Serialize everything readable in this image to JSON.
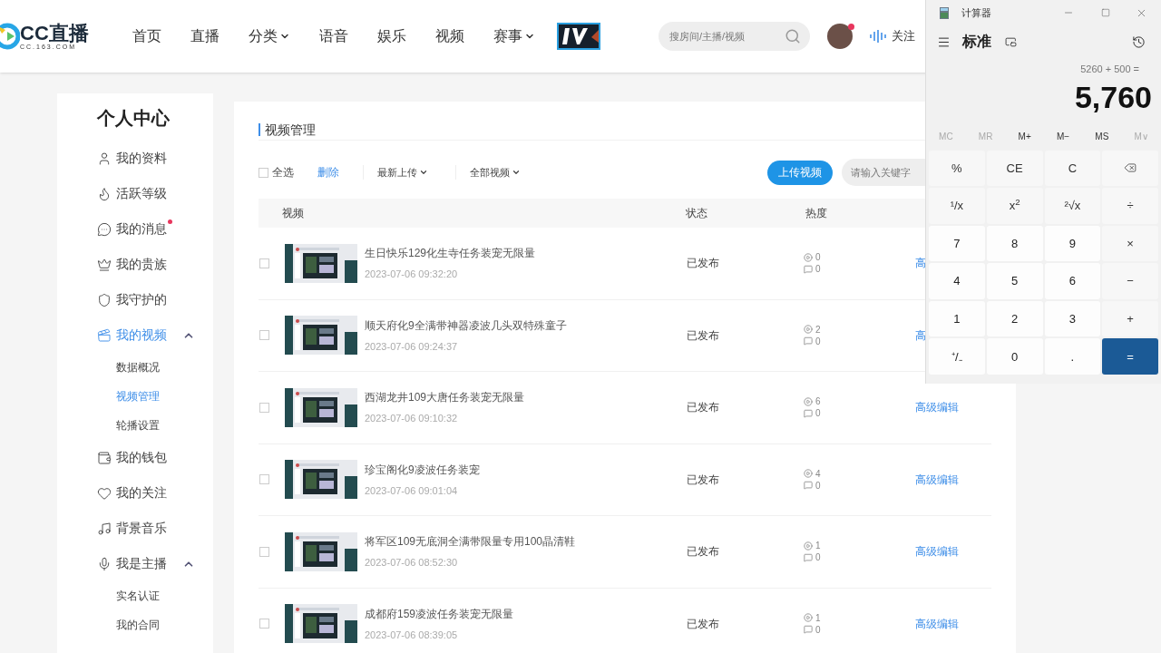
{
  "header": {
    "logo": {
      "text": "CC直播",
      "subtext": "CC.163.COM"
    },
    "nav": [
      {
        "label": "首页",
        "dropdown": false
      },
      {
        "label": "直播",
        "dropdown": false
      },
      {
        "label": "分类",
        "dropdown": true
      },
      {
        "label": "语音",
        "dropdown": false
      },
      {
        "label": "娱乐",
        "dropdown": false
      },
      {
        "label": "视频",
        "dropdown": false
      },
      {
        "label": "赛事",
        "dropdown": true
      }
    ],
    "search": {
      "placeholder": "搜房间/主播/视频"
    },
    "follow": "关注",
    "avatar_notification": true
  },
  "sidebar": {
    "title": "个人中心",
    "items": [
      {
        "label": "我的资料",
        "selected": false,
        "notification": false
      },
      {
        "label": "活跃等级",
        "selected": false,
        "notification": false
      },
      {
        "label": "我的消息",
        "selected": false,
        "notification": true
      },
      {
        "label": "我的贵族",
        "selected": false,
        "notification": false
      },
      {
        "label": "我守护的",
        "selected": false,
        "notification": false
      },
      {
        "label": "我的视频",
        "selected": true,
        "notification": false,
        "expanded": true,
        "children": [
          {
            "label": "数据概况",
            "selected": false
          },
          {
            "label": "视频管理",
            "selected": true
          },
          {
            "label": "轮播设置",
            "selected": false
          }
        ]
      },
      {
        "label": "我的钱包",
        "selected": false,
        "notification": false
      },
      {
        "label": "我的关注",
        "selected": false,
        "notification": false
      },
      {
        "label": "背景音乐",
        "selected": false,
        "notification": false
      },
      {
        "label": "我是主播",
        "selected": false,
        "notification": false,
        "expanded": true,
        "children": [
          {
            "label": "实名认证",
            "selected": false
          },
          {
            "label": "我的合同",
            "selected": false
          }
        ]
      }
    ]
  },
  "main": {
    "title": "视频管理",
    "select_all": {
      "label": "全选",
      "checked": false
    },
    "delete": "删除",
    "filters": [
      {
        "label": "最新上传"
      },
      {
        "label": "全部视频"
      }
    ],
    "upload": "上传视频",
    "search": {
      "placeholder": "请输入关键字"
    },
    "columns": [
      "视频",
      "状态",
      "热度"
    ],
    "rows": [
      {
        "checked": false,
        "title": "生日快乐129化生寺任务装宠无限量",
        "time": "2023-07-06 09:32:20",
        "status": "已发布",
        "plays": "0",
        "comments": "0",
        "action": "高"
      },
      {
        "checked": false,
        "title": "顺天府化9全满带神器凌波几头双特殊童子",
        "time": "2023-07-06 09:24:37",
        "status": "已发布",
        "plays": "2",
        "comments": "0",
        "action": "高"
      },
      {
        "checked": false,
        "title": "西湖龙井109大唐任务装宠无限量",
        "time": "2023-07-06 09:10:32",
        "status": "已发布",
        "plays": "6",
        "comments": "0",
        "action": "高级编辑"
      },
      {
        "checked": false,
        "title": "珍宝阁化9凌波任务装宠",
        "time": "2023-07-06 09:01:04",
        "status": "已发布",
        "plays": "4",
        "comments": "0",
        "action": "高级编辑"
      },
      {
        "checked": false,
        "title": "将军区109无底洞全满带限量专用100晶清鞋",
        "time": "2023-07-06 08:52:30",
        "status": "已发布",
        "plays": "1",
        "comments": "0",
        "action": "高级编辑"
      },
      {
        "checked": false,
        "title": "成都府159凌波任务装宠无限量",
        "time": "2023-07-06 08:39:05",
        "status": "已发布",
        "plays": "1",
        "comments": "0",
        "action": "高级编辑"
      }
    ]
  },
  "calculator": {
    "title": "计算器",
    "mode": "标准",
    "expression": "5260 + 500 =",
    "display": "5,760",
    "memory": [
      {
        "label": "MC",
        "disabled": true
      },
      {
        "label": "MR",
        "disabled": true
      },
      {
        "label": "M+",
        "disabled": false
      },
      {
        "label": "M−",
        "disabled": false
      },
      {
        "label": "MS",
        "disabled": false
      },
      {
        "label": "M∨",
        "disabled": true
      }
    ],
    "keys": [
      {
        "kind": "op",
        "label": "%"
      },
      {
        "kind": "op",
        "label": "CE"
      },
      {
        "kind": "op",
        "label": "C"
      },
      {
        "kind": "backspace"
      },
      {
        "kind": "op",
        "label": "¹/x"
      },
      {
        "kind": "op",
        "label": "x$^{2}$"
      },
      {
        "kind": "op",
        "label": "²√x"
      },
      {
        "kind": "op",
        "label": "÷"
      },
      {
        "kind": "digit",
        "label": "7"
      },
      {
        "kind": "digit",
        "label": "8"
      },
      {
        "kind": "digit",
        "label": "9"
      },
      {
        "kind": "op",
        "label": "×"
      },
      {
        "kind": "digit",
        "label": "4"
      },
      {
        "kind": "digit",
        "label": "5"
      },
      {
        "kind": "digit",
        "label": "6"
      },
      {
        "kind": "op",
        "label": "−"
      },
      {
        "kind": "digit",
        "label": "1"
      },
      {
        "kind": "digit",
        "label": "2"
      },
      {
        "kind": "digit",
        "label": "3"
      },
      {
        "kind": "op",
        "label": "+"
      },
      {
        "kind": "digit",
        "label": "⁺/₋"
      },
      {
        "kind": "digit",
        "label": "0"
      },
      {
        "kind": "digit",
        "label": "."
      },
      {
        "kind": "equals",
        "label": "="
      }
    ]
  }
}
